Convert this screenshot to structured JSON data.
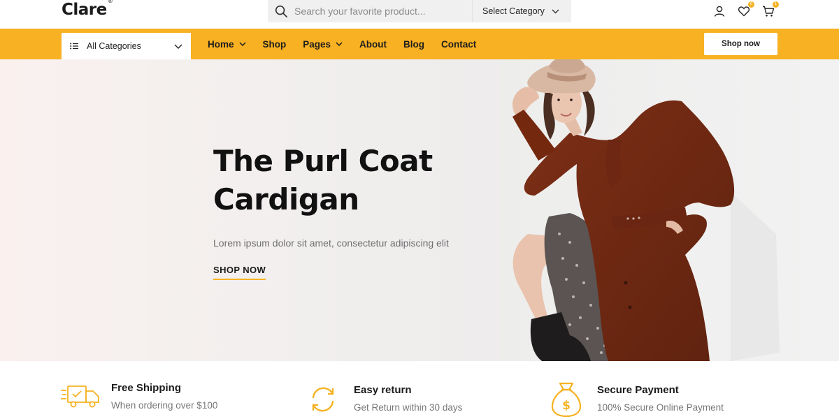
{
  "header": {
    "logo": "Clare",
    "logo_mark": "®",
    "search": {
      "placeholder": "Search your favorite product..."
    },
    "category_select": "Select Category",
    "wishlist_count": "0",
    "cart_count": "1"
  },
  "nav": {
    "all_categories": "All Categories",
    "items": [
      {
        "label": "Home",
        "dropdown": true
      },
      {
        "label": "Shop",
        "dropdown": false
      },
      {
        "label": "Pages",
        "dropdown": true
      },
      {
        "label": "About",
        "dropdown": false
      },
      {
        "label": "Blog",
        "dropdown": false
      },
      {
        "label": "Contact",
        "dropdown": false
      }
    ],
    "cta": "Shop now",
    "bar_color": "#f8b123"
  },
  "hero": {
    "title_line1": "The Purl Coat",
    "title_line2": "Cardigan",
    "subtitle": "Lorem ipsum dolor sit amet, consectetur adipiscing elit",
    "cta": "SHOP NOW"
  },
  "features": [
    {
      "icon": "truck-icon",
      "title": "Free Shipping",
      "desc": "When ordering over $100"
    },
    {
      "icon": "refresh-icon",
      "title": "Easy return",
      "desc": "Get Return within 30 days"
    },
    {
      "icon": "money-bag-icon",
      "title": "Secure Payment",
      "desc": "100% Secure Online Payment"
    }
  ],
  "accent_color": "#f5b223"
}
